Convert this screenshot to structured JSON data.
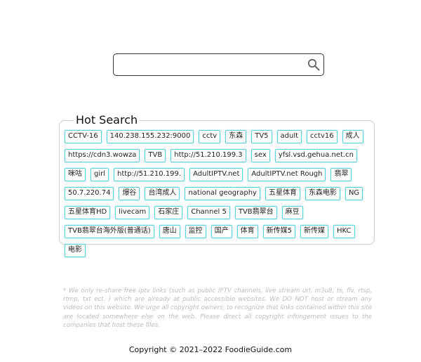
{
  "search": {
    "placeholder": "",
    "value": "",
    "icon": "search-icon"
  },
  "hot_search": {
    "title": "Hot Search",
    "tags": [
      "CCTV-16",
      "140.238.155.232:9000",
      "cctv",
      "东森",
      "TV5",
      "adult",
      "cctv16",
      "成人",
      "https://cdn3.wowza",
      "TVB",
      "http://51.210.199.3",
      "sex",
      "yfsl.vsd.gehua.net.cn",
      "咪咕",
      "girl",
      "http://51.210.199.",
      "AdultIPTV.net",
      "AdultIPTV.net Rough",
      "翡翠",
      "50.7.220.74",
      "爆谷",
      "台湾成人",
      "national geography",
      "五星体育",
      "东森电影",
      "NG",
      "五星体育HD",
      "livecam",
      "石家庄",
      "Channel 5",
      "TVB翡翠台",
      "麻豆",
      "TVB翡翠台海外版(普通话)",
      "唐山",
      "监控",
      "国产",
      "体育",
      "新传媒5",
      "新传媒",
      "HKC",
      "电影"
    ]
  },
  "disclaimer": "* We only re-share free iptv links (such as public IPTV channels, live stream url, m3u8, ts, flv, rtsp, rtmp, txt ect. ) which are already at public accessible websites. We DO NOT host or stream any videos on this website. We urge all copyright owners, to recognize that links contained within this site are located somewhere else on the web. Please direct all copyright infringement issues to the companies that host these files.",
  "footer": {
    "copyright": "Copyright © 2021–2022 FoodieGuide.com"
  },
  "colors": {
    "tag_border": "#5fd3dc",
    "disclaimer_text": "#bdbdbd"
  }
}
